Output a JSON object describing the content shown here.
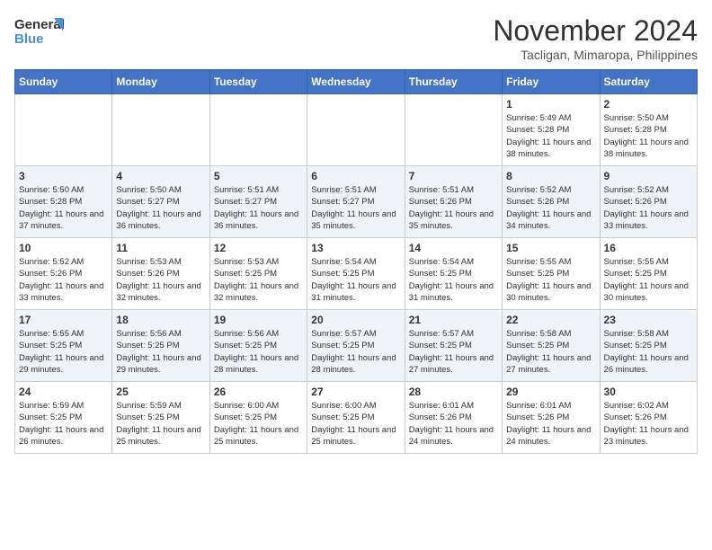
{
  "header": {
    "logo_line1": "General",
    "logo_line2": "Blue",
    "month": "November 2024",
    "location": "Tacligan, Mimaropa, Philippines"
  },
  "weekdays": [
    "Sunday",
    "Monday",
    "Tuesday",
    "Wednesday",
    "Thursday",
    "Friday",
    "Saturday"
  ],
  "weeks": [
    [
      {
        "day": "",
        "info": ""
      },
      {
        "day": "",
        "info": ""
      },
      {
        "day": "",
        "info": ""
      },
      {
        "day": "",
        "info": ""
      },
      {
        "day": "",
        "info": ""
      },
      {
        "day": "1",
        "info": "Sunrise: 5:49 AM\nSunset: 5:28 PM\nDaylight: 11 hours and 38 minutes."
      },
      {
        "day": "2",
        "info": "Sunrise: 5:50 AM\nSunset: 5:28 PM\nDaylight: 11 hours and 38 minutes."
      }
    ],
    [
      {
        "day": "3",
        "info": "Sunrise: 5:50 AM\nSunset: 5:28 PM\nDaylight: 11 hours and 37 minutes."
      },
      {
        "day": "4",
        "info": "Sunrise: 5:50 AM\nSunset: 5:27 PM\nDaylight: 11 hours and 36 minutes."
      },
      {
        "day": "5",
        "info": "Sunrise: 5:51 AM\nSunset: 5:27 PM\nDaylight: 11 hours and 36 minutes."
      },
      {
        "day": "6",
        "info": "Sunrise: 5:51 AM\nSunset: 5:27 PM\nDaylight: 11 hours and 35 minutes."
      },
      {
        "day": "7",
        "info": "Sunrise: 5:51 AM\nSunset: 5:26 PM\nDaylight: 11 hours and 35 minutes."
      },
      {
        "day": "8",
        "info": "Sunrise: 5:52 AM\nSunset: 5:26 PM\nDaylight: 11 hours and 34 minutes."
      },
      {
        "day": "9",
        "info": "Sunrise: 5:52 AM\nSunset: 5:26 PM\nDaylight: 11 hours and 33 minutes."
      }
    ],
    [
      {
        "day": "10",
        "info": "Sunrise: 5:52 AM\nSunset: 5:26 PM\nDaylight: 11 hours and 33 minutes."
      },
      {
        "day": "11",
        "info": "Sunrise: 5:53 AM\nSunset: 5:26 PM\nDaylight: 11 hours and 32 minutes."
      },
      {
        "day": "12",
        "info": "Sunrise: 5:53 AM\nSunset: 5:25 PM\nDaylight: 11 hours and 32 minutes."
      },
      {
        "day": "13",
        "info": "Sunrise: 5:54 AM\nSunset: 5:25 PM\nDaylight: 11 hours and 31 minutes."
      },
      {
        "day": "14",
        "info": "Sunrise: 5:54 AM\nSunset: 5:25 PM\nDaylight: 11 hours and 31 minutes."
      },
      {
        "day": "15",
        "info": "Sunrise: 5:55 AM\nSunset: 5:25 PM\nDaylight: 11 hours and 30 minutes."
      },
      {
        "day": "16",
        "info": "Sunrise: 5:55 AM\nSunset: 5:25 PM\nDaylight: 11 hours and 30 minutes."
      }
    ],
    [
      {
        "day": "17",
        "info": "Sunrise: 5:55 AM\nSunset: 5:25 PM\nDaylight: 11 hours and 29 minutes."
      },
      {
        "day": "18",
        "info": "Sunrise: 5:56 AM\nSunset: 5:25 PM\nDaylight: 11 hours and 29 minutes."
      },
      {
        "day": "19",
        "info": "Sunrise: 5:56 AM\nSunset: 5:25 PM\nDaylight: 11 hours and 28 minutes."
      },
      {
        "day": "20",
        "info": "Sunrise: 5:57 AM\nSunset: 5:25 PM\nDaylight: 11 hours and 28 minutes."
      },
      {
        "day": "21",
        "info": "Sunrise: 5:57 AM\nSunset: 5:25 PM\nDaylight: 11 hours and 27 minutes."
      },
      {
        "day": "22",
        "info": "Sunrise: 5:58 AM\nSunset: 5:25 PM\nDaylight: 11 hours and 27 minutes."
      },
      {
        "day": "23",
        "info": "Sunrise: 5:58 AM\nSunset: 5:25 PM\nDaylight: 11 hours and 26 minutes."
      }
    ],
    [
      {
        "day": "24",
        "info": "Sunrise: 5:59 AM\nSunset: 5:25 PM\nDaylight: 11 hours and 26 minutes."
      },
      {
        "day": "25",
        "info": "Sunrise: 5:59 AM\nSunset: 5:25 PM\nDaylight: 11 hours and 25 minutes."
      },
      {
        "day": "26",
        "info": "Sunrise: 6:00 AM\nSunset: 5:25 PM\nDaylight: 11 hours and 25 minutes."
      },
      {
        "day": "27",
        "info": "Sunrise: 6:00 AM\nSunset: 5:25 PM\nDaylight: 11 hours and 25 minutes."
      },
      {
        "day": "28",
        "info": "Sunrise: 6:01 AM\nSunset: 5:26 PM\nDaylight: 11 hours and 24 minutes."
      },
      {
        "day": "29",
        "info": "Sunrise: 6:01 AM\nSunset: 5:26 PM\nDaylight: 11 hours and 24 minutes."
      },
      {
        "day": "30",
        "info": "Sunrise: 6:02 AM\nSunset: 5:26 PM\nDaylight: 11 hours and 23 minutes."
      }
    ]
  ]
}
